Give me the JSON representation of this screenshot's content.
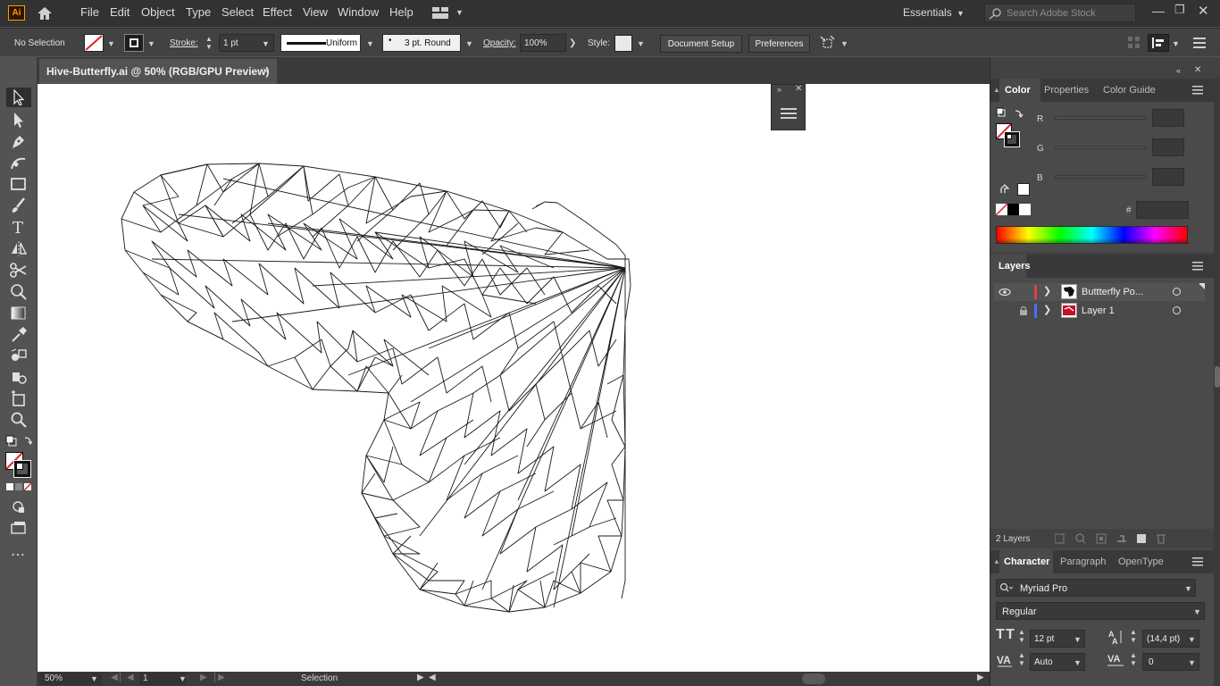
{
  "app": {
    "logo": "Ai",
    "menu": [
      "File",
      "Edit",
      "Object",
      "Type",
      "Select",
      "Effect",
      "View",
      "Window",
      "Help"
    ],
    "workspace": "Essentials",
    "search_placeholder": "Search Adobe Stock"
  },
  "controlbar": {
    "selection": "No Selection",
    "stroke_label": "Stroke:",
    "stroke_value": "1 pt",
    "profile": "Uniform",
    "brush": "3 pt. Round",
    "opacity_label": "Opacity:",
    "opacity_value": "100%",
    "style_label": "Style:",
    "document_setup": "Document Setup",
    "preferences": "Preferences"
  },
  "document": {
    "tab_title": "Hive-Butterfly.ai @ 50% (RGB/GPU Preview)",
    "close": "×"
  },
  "statusbar": {
    "zoom": "50%",
    "page": "1",
    "tool": "Selection"
  },
  "color_panel": {
    "tabs": [
      "Color",
      "Properties",
      "Color Guide"
    ],
    "channels": [
      "R",
      "G",
      "B"
    ],
    "hex_label": "#"
  },
  "layers_panel": {
    "tab": "Layers",
    "layers": [
      {
        "name": "Buttterfly Po...",
        "color": "#e04040"
      },
      {
        "name": "Layer 1",
        "color": "#4f6cff"
      }
    ],
    "count": "2 Layers"
  },
  "character_panel": {
    "tabs": [
      "Character",
      "Paragraph",
      "OpenType"
    ],
    "font": "Myriad Pro",
    "style": "Regular",
    "size": "12 pt",
    "leading": "(14,4 pt)",
    "kerning": "Auto",
    "tracking": "0"
  },
  "colors": {
    "accent": "#ff9a00",
    "menubar": "#323232",
    "panel": "#424242",
    "canvas": "#ffffff"
  }
}
